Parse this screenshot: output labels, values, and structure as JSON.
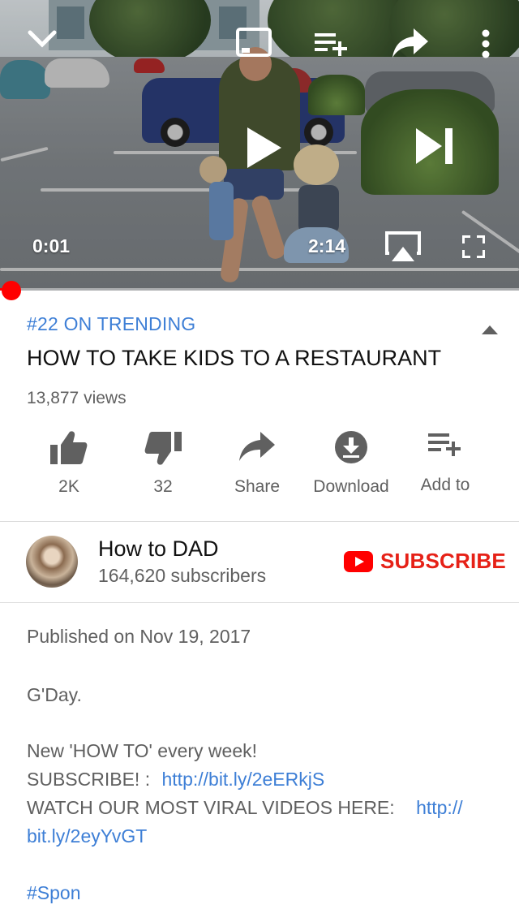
{
  "player": {
    "current_time": "0:01",
    "duration": "2:14",
    "progress": 0.007,
    "icons": {
      "collapse": "chevron-down-icon",
      "cast": "cast-icon",
      "add_to_queue": "playlist-add-icon",
      "share": "share-icon",
      "more": "more-vertical-icon",
      "play": "play-icon",
      "next": "skip-next-icon",
      "airplay": "airplay-icon",
      "fullscreen": "fullscreen-icon"
    }
  },
  "video": {
    "trending": "#22 ON TRENDING",
    "title": "HOW TO TAKE KIDS TO A RESTAURANT",
    "views": "13,877 views"
  },
  "actions": [
    {
      "label": "2K",
      "icon": "thumbs-up-icon"
    },
    {
      "label": "32",
      "icon": "thumbs-down-icon"
    },
    {
      "label": "Share",
      "icon": "share-icon"
    },
    {
      "label": "Download",
      "icon": "download-icon"
    },
    {
      "label": "Add to",
      "icon": "playlist-add-icon"
    }
  ],
  "channel": {
    "name": "How to DAD",
    "subscribers": "164,620 subscribers",
    "subscribe_label": "SUBSCRIBE"
  },
  "description": {
    "published": "Published on Nov 19, 2017",
    "greeting": "G'Day.",
    "line1": "New 'HOW TO' every week!",
    "subscribe_prefix": "SUBSCRIBE! :",
    "subscribe_link": "http://bit.ly/2eERkjS",
    "watch_prefix": "WATCH OUR MOST VIRAL VIDEOS HERE:",
    "watch_link_part1": "http://",
    "watch_link_part2": "bit.ly/2eyYvGT",
    "hashtag": "#Spon"
  },
  "colors": {
    "accent_blue": "#3e7fd6",
    "youtube_red": "#e62117",
    "progress_red": "#ff0000",
    "secondary_text": "#606060"
  }
}
